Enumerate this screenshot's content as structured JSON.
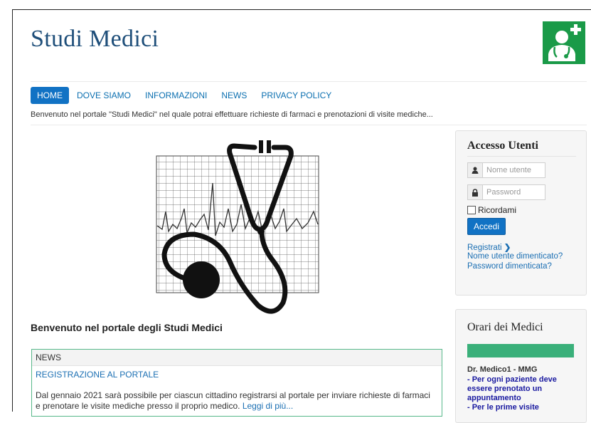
{
  "site": {
    "title": "Studi Medici"
  },
  "nav": {
    "items": [
      {
        "label": "HOME"
      },
      {
        "label": "DOVE SIAMO"
      },
      {
        "label": "INFORMAZIONI"
      },
      {
        "label": "NEWS"
      },
      {
        "label": "PRIVACY POLICY"
      }
    ],
    "active_index": 0
  },
  "welcome_text": "Benvenuto nel portale \"Studi Medici\" nel quale potrai effettuare richieste di farmaci e prenotazioni di visite mediche...",
  "main": {
    "heading": "Benvenuto nel portale degli Studi Medici",
    "news": {
      "header": "NEWS",
      "title": "REGISTRAZIONE AL PORTALE",
      "body": "Dal gennaio 2021 sarà possibile per ciascun cittadino registrarsi al portale per inviare richieste di farmaci e prenotare le visite mediche presso il proprio medico.",
      "read_more": "Leggi di più..."
    }
  },
  "login": {
    "title": "Accesso Utenti",
    "username_placeholder": "Nome utente",
    "password_placeholder": "Password",
    "remember_label": "Ricordami",
    "submit_label": "Accedi",
    "register_label": "Registrati",
    "forgot_username": "Nome utente dimenticato?",
    "forgot_password": "Password dimenticata?"
  },
  "orari": {
    "title": "Orari dei Medici",
    "doctor": "Dr. Medico1 - MMG",
    "note_lines": [
      "- Per ogni paziente deve essere prenotato un appuntamento",
      "- Per le prime visite"
    ]
  },
  "colors": {
    "accent": "#1172c4",
    "brand_green": "#1a9a48",
    "title_blue": "#1f4f7a"
  }
}
